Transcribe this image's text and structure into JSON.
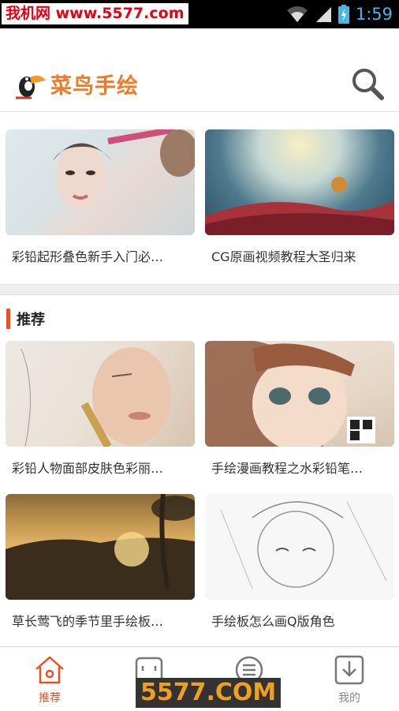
{
  "status_bar": {
    "watermark": "我机网 www.5577.com",
    "time": "1:59",
    "icons": [
      "wifi-icon",
      "signal-icon",
      "battery-icon"
    ]
  },
  "header": {
    "logo_text": "菜鸟手绘",
    "search_icon": "search-icon"
  },
  "top_cards": [
    {
      "title": "彩铅起形叠色新手入门必…"
    },
    {
      "title": "CG原画视频教程大圣归来"
    }
  ],
  "section": {
    "title": "推荐"
  },
  "recommend_cards": [
    {
      "title": "彩铅人物面部皮肤色彩丽…"
    },
    {
      "title": "手绘漫画教程之水彩铅笔…"
    },
    {
      "title": "草长莺飞的季节里手绘板…"
    },
    {
      "title": "手绘板怎么画Q版角色"
    }
  ],
  "tabbar": {
    "tabs": [
      {
        "label": "推荐",
        "icon": "home-icon",
        "active": true
      },
      {
        "label": "",
        "icon": "category-icon",
        "active": false
      },
      {
        "label": "",
        "icon": "list-icon",
        "active": false
      },
      {
        "label": "我的",
        "icon": "download-icon",
        "active": false
      }
    ]
  },
  "bottom_watermark": "5577.COM",
  "colors": {
    "accent": "#f04e1e",
    "logo": "#f07b26",
    "time": "#4bb6e6"
  }
}
